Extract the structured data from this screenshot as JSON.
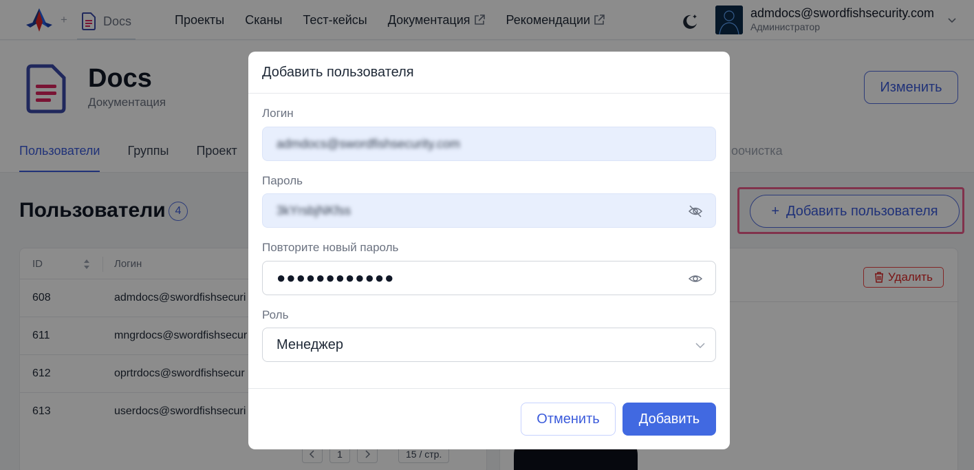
{
  "navbar": {
    "project_name": "Docs",
    "plus": "+",
    "items": [
      {
        "label": "Проекты"
      },
      {
        "label": "Сканы"
      },
      {
        "label": "Тест-кейсы"
      },
      {
        "label": "Документация"
      },
      {
        "label": "Рекомендации"
      }
    ],
    "user_email": "admdocs@swordfishsecurity.com",
    "user_role": "Администратор"
  },
  "header": {
    "title": "Docs",
    "subtitle": "Документация",
    "edit_label": "Изменить",
    "tabs": [
      {
        "label": "Пользователи"
      },
      {
        "label": "Группы"
      },
      {
        "label": "Проект"
      }
    ],
    "tab_far": "оочистка"
  },
  "users_section": {
    "title": "Пользователи",
    "count": "4",
    "add_label": "Добавить пользователя",
    "add_plus": "+",
    "columns": {
      "id": "ID",
      "login": "Логин"
    },
    "rows": [
      {
        "id": "608",
        "login": "admdocs@swordfishsecuri"
      },
      {
        "id": "611",
        "login": "mngrdocs@swordfishsecur"
      },
      {
        "id": "612",
        "login": "oprtrdocs@swordfishsecur"
      },
      {
        "id": "613",
        "login": "userdocs@swordfishsecuri"
      }
    ],
    "pager": {
      "page": "1",
      "size": "15 / стр."
    },
    "delete_label": "Удалить"
  },
  "modal": {
    "title": "Добавить пользователя",
    "login_label": "Логин",
    "login_value": "admdocs@swordfishsecurity.com",
    "password_label": "Пароль",
    "password_value": "3kYrsbjNKfss",
    "repeat_label": "Повторите новый пароль",
    "repeat_value": "●●●●●●●●●●●●",
    "role_label": "Роль",
    "role_value": "Менеджер",
    "cancel_label": "Отменить",
    "submit_label": "Добавить"
  },
  "colors": {
    "accent": "#4169e1",
    "highlight": "#ec5b8b",
    "danger": "#dc2626"
  }
}
